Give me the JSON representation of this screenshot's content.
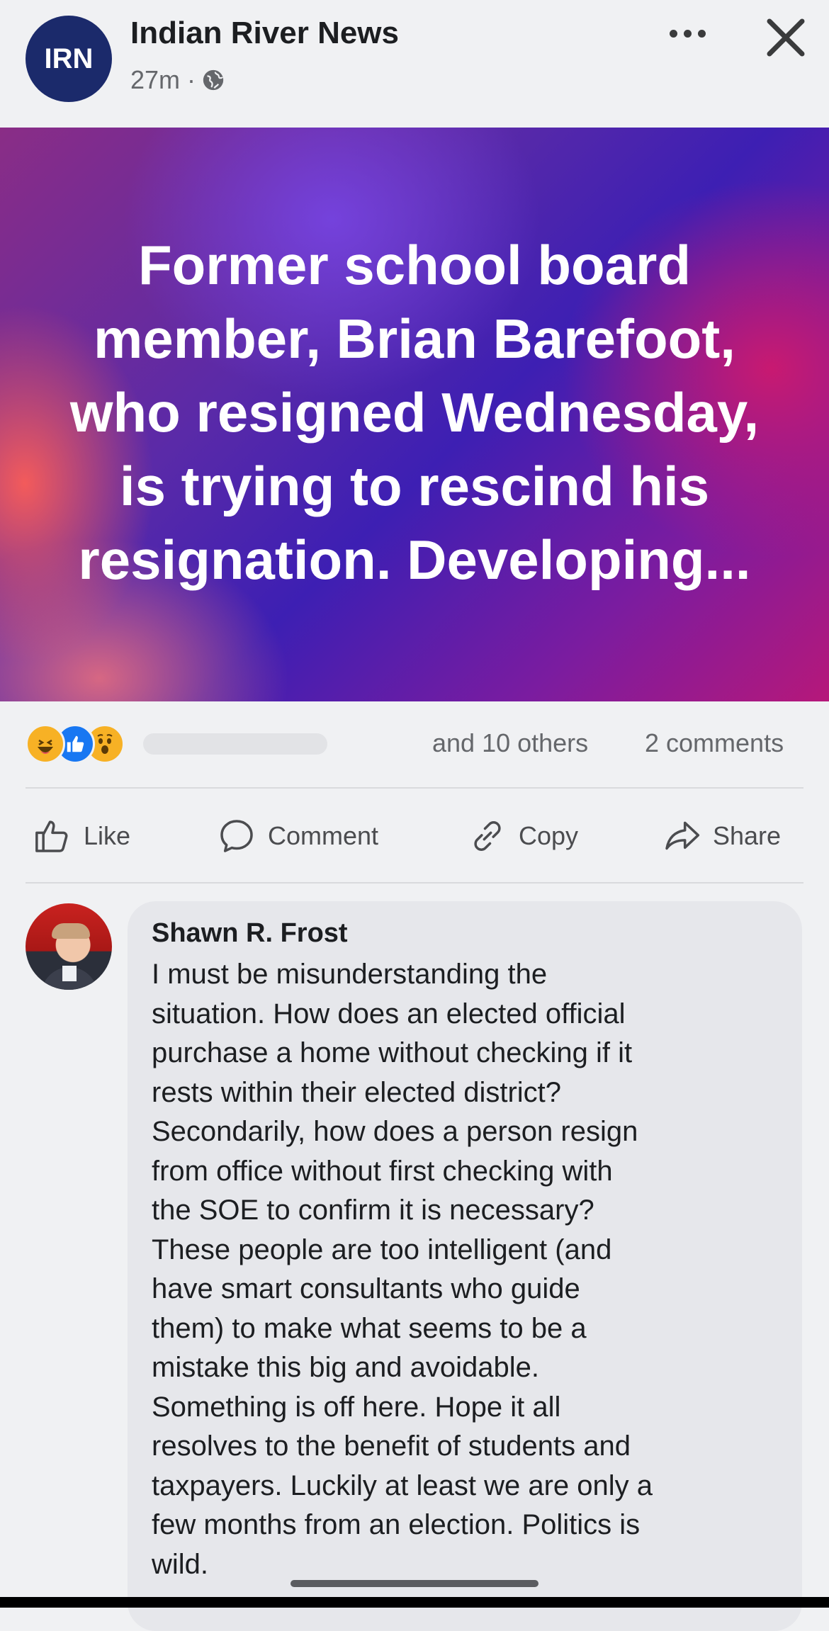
{
  "post": {
    "page_name": "Indian River News",
    "avatar_text": "IRN",
    "time": "27m ·",
    "image_text": "Former school board member, Brian Barefoot, who resigned Wednesday, is trying to rescind his resignation. Developing..."
  },
  "reactions": {
    "summary": "and 10 others",
    "comments": "2 comments",
    "icons": [
      "haha-reaction",
      "like-reaction",
      "wow-reaction"
    ]
  },
  "actions": {
    "like": "Like",
    "comment": "Comment",
    "copy": "Copy",
    "share": "Share"
  },
  "comment": {
    "author": "Shawn R. Frost",
    "text": "I must be misunderstanding the\nsituation. How does an elected official\npurchase a home without checking if it\nrests within their elected district?\nSecondarily, how does a person resign\nfrom office without first checking with\nthe SOE to confirm it is necessary?\nThese people are too intelligent (and\nhave smart consultants who guide\nthem) to make what seems to be a\nmistake this big and avoidable.\nSomething is off here. Hope it all\nresolves to the benefit of students and\ntaxpayers. Luckily at least we are only a\nfew months from an election. Politics is\nwild."
  },
  "colors": {
    "logo_bg": "#1b2a6b",
    "like_blue": "#1877f2",
    "reaction_yellow": "#f7b125",
    "muted_text": "#65676b"
  }
}
